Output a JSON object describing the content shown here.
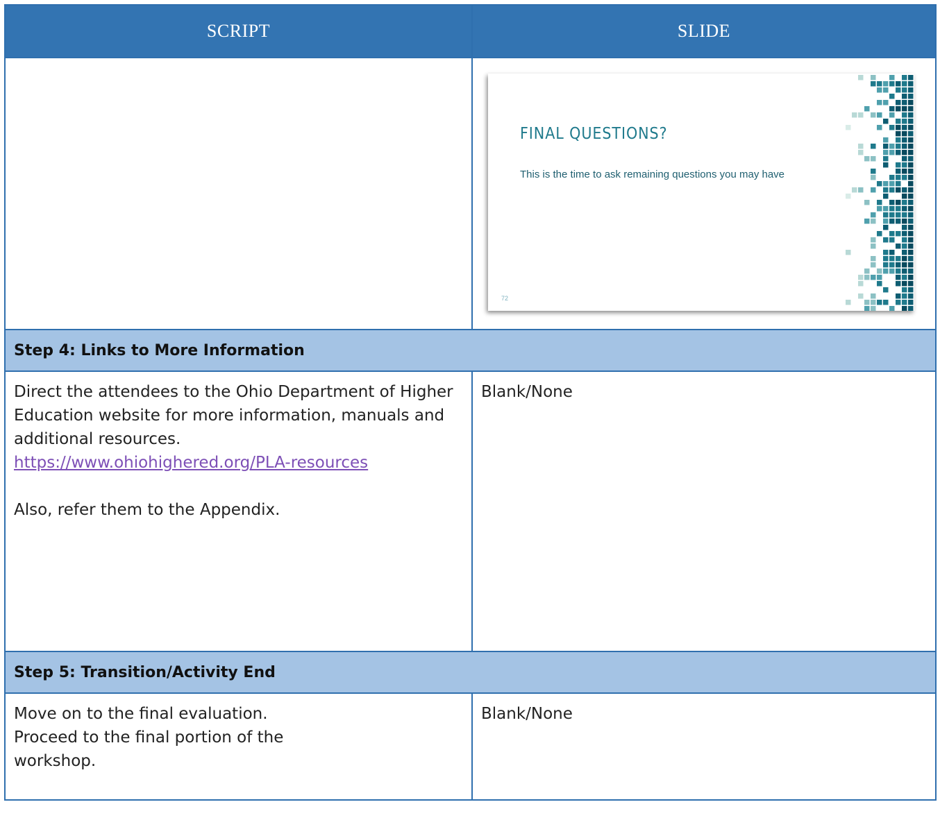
{
  "header": {
    "script_label": "SCRIPT",
    "slide_label": "SLIDE"
  },
  "slide": {
    "title": "FINAL QUESTIONS?",
    "subtitle": "This is the time to ask remaining questions you may have",
    "page_number": "72"
  },
  "step4": {
    "heading": "Step 4: Links to More Information",
    "script_text": "Direct the attendees to the Ohio Department of Higher Education website for more information, manuals  and additional resources.",
    "link_text": "https://www.ohiohighered.org/PLA-resources",
    "script_text2": "Also, refer them to the Appendix.",
    "slide_text": "Blank/None"
  },
  "step5": {
    "heading": "Step 5: Transition/Activity End",
    "script_line1": "Move on to the final evaluation.",
    "script_line2": "Proceed to the final portion of the",
    "script_line3": "workshop.",
    "slide_text": "Blank/None"
  },
  "colors": {
    "header_bg": "#3374b2",
    "step_bg": "#a4c3e4",
    "border": "#2f6fae",
    "link": "#7d4fb6",
    "slide_title": "#1f7a8c"
  }
}
